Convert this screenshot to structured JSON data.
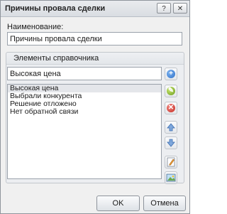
{
  "window": {
    "title": "Причины провала сделки",
    "help": "?",
    "close": "✕"
  },
  "name_field": {
    "label": "Наименование:",
    "value": "Причины провала сделки"
  },
  "group": {
    "title": "Элементы справочника",
    "current_value": "Высокая цена",
    "items": [
      "Высокая цена",
      "Выбрали конкурента",
      "Решение отложено",
      "Нет обратной связи"
    ],
    "selected_index": 0
  },
  "side_buttons": [
    "add-icon",
    "edit-icon",
    "delete-icon",
    "move-up-icon",
    "move-down-icon",
    "edit-item-icon",
    "image-icon"
  ],
  "buttons": {
    "ok": "OK",
    "cancel": "Отмена"
  }
}
